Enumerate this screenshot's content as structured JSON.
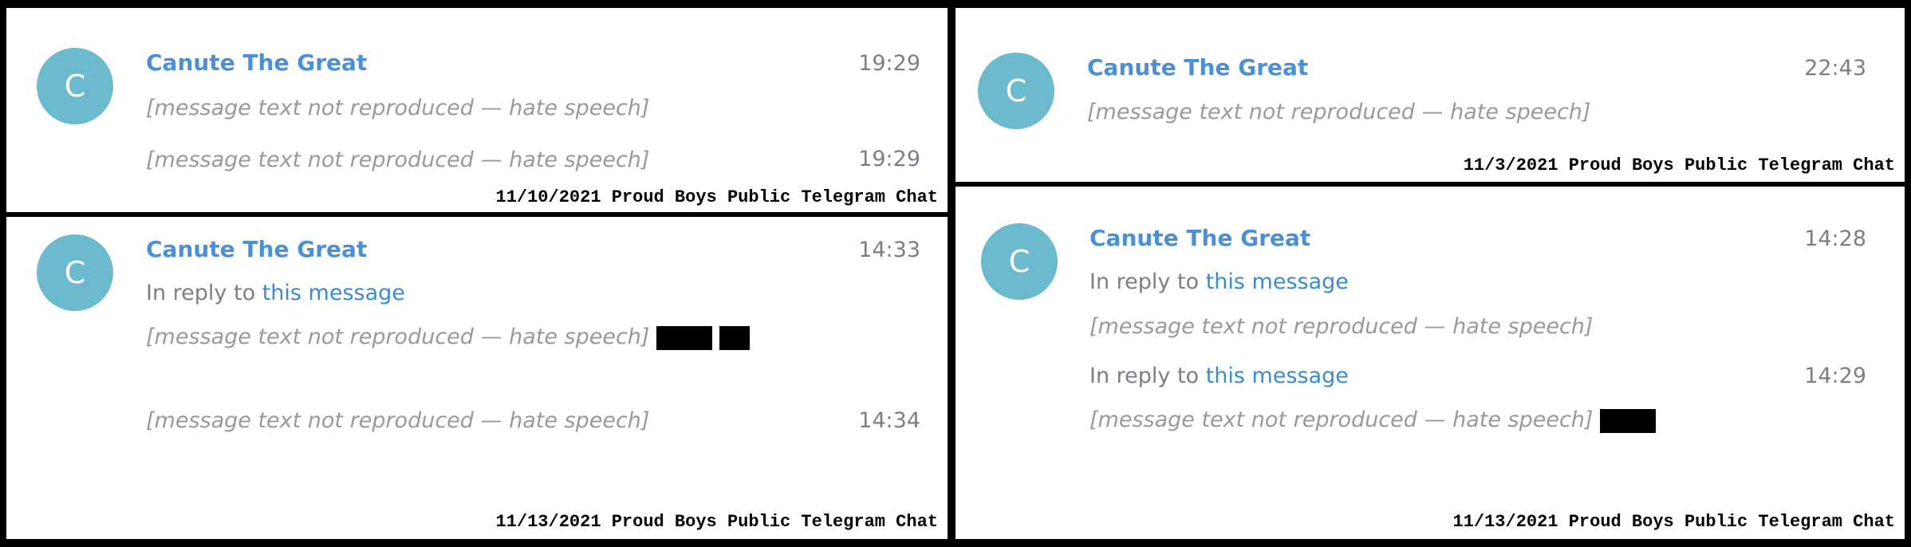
{
  "note": "Message bodies replaced with placeholders; original content contains hate speech and is not reproduced.",
  "avatar_letter": "C",
  "username": "Canute The Great",
  "reply_prefix": "In reply to",
  "reply_link": "this message",
  "placeholder": "[message text not reproduced — hate speech]",
  "panels": [
    {
      "times": [
        "19:29",
        "19:29"
      ],
      "caption": "11/10/2021 Proud Boys Public Telegram Chat"
    },
    {
      "times": [
        "14:33",
        "14:34"
      ],
      "caption": "11/13/2021 Proud Boys Public Telegram Chat"
    },
    {
      "times": [
        "22:43"
      ],
      "caption": "11/3/2021 Proud Boys Public Telegram Chat"
    },
    {
      "times": [
        "14:28",
        "14:29"
      ],
      "caption": "11/13/2021 Proud Boys Public Telegram Chat"
    }
  ]
}
